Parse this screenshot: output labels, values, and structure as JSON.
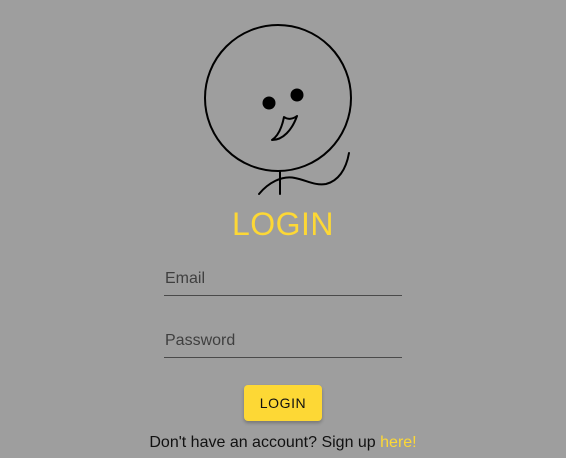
{
  "mascot": {
    "icon": "stick-figure-face-icon",
    "stroke_color": "#000000"
  },
  "title": "LOGIN",
  "form": {
    "email_placeholder": "Email",
    "email_value": "",
    "password_placeholder": "Password",
    "password_value": ""
  },
  "login_button_label": "LOGIN",
  "signup": {
    "prompt": "Don't have an account? Sign up",
    "link_text": "here!"
  },
  "colors": {
    "background": "#9e9e9e",
    "accent": "#fdd835",
    "text": "#111111"
  }
}
